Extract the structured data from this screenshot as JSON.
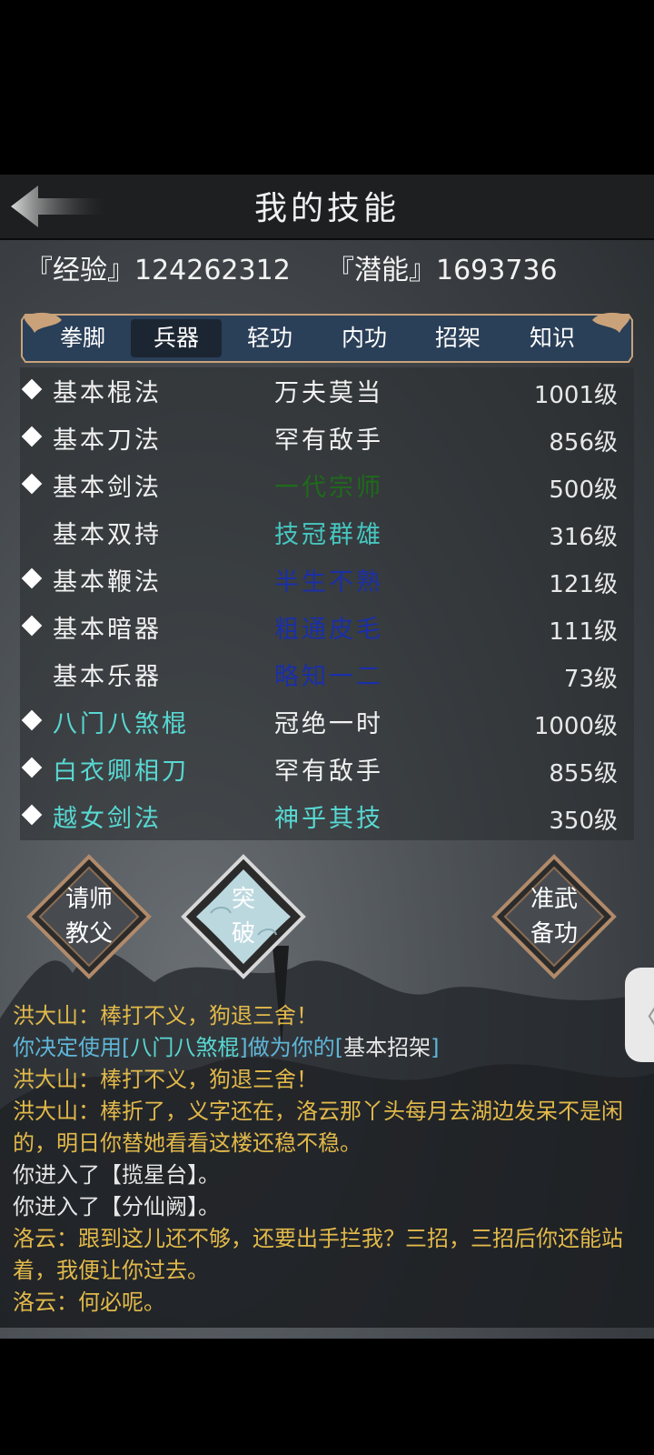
{
  "header": {
    "title": "我的技能"
  },
  "stats": {
    "exp_label": "『经验』",
    "exp_value": "124262312",
    "pot_label": "『潜能』",
    "pot_value": "1693736"
  },
  "tabs": [
    {
      "label": "拳脚"
    },
    {
      "label": "兵器"
    },
    {
      "label": "轻功"
    },
    {
      "label": "内功"
    },
    {
      "label": "招架"
    },
    {
      "label": "知识"
    }
  ],
  "active_tab": "兵器",
  "skills": [
    {
      "name": "基本棍法",
      "rank": "万夫莫当",
      "level": "1001级",
      "marked": true,
      "name_color": "#f2f2f2",
      "rank_color": "#f2f2f2"
    },
    {
      "name": "基本刀法",
      "rank": "罕有敌手",
      "level": "856级",
      "marked": true,
      "name_color": "#f2f2f2",
      "rank_color": "#f2f2f2"
    },
    {
      "name": "基本剑法",
      "rank": "一代宗师",
      "level": "500级",
      "marked": true,
      "name_color": "#f2f2f2",
      "rank_color": "#1e6b1a"
    },
    {
      "name": "基本双持",
      "rank": "技冠群雄",
      "level": "316级",
      "marked": false,
      "name_color": "#f2f2f2",
      "rank_color": "#47c6c0"
    },
    {
      "name": "基本鞭法",
      "rank": "半生不熟",
      "level": "121级",
      "marked": true,
      "name_color": "#f2f2f2",
      "rank_color": "#1a2fa8"
    },
    {
      "name": "基本暗器",
      "rank": "粗通皮毛",
      "level": "111级",
      "marked": true,
      "name_color": "#f2f2f2",
      "rank_color": "#1a2fa8"
    },
    {
      "name": "基本乐器",
      "rank": "略知一二",
      "level": "73级",
      "marked": false,
      "name_color": "#f2f2f2",
      "rank_color": "#1a2fa8"
    },
    {
      "name": "八门八煞棍",
      "rank": "冠绝一时",
      "level": "1000级",
      "marked": true,
      "name_color": "#58d8d2",
      "rank_color": "#f2f2f2"
    },
    {
      "name": "白衣卿相刀",
      "rank": "罕有敌手",
      "level": "855级",
      "marked": true,
      "name_color": "#58d8d2",
      "rank_color": "#f2f2f2"
    },
    {
      "name": "越女剑法",
      "rank": "神乎其技",
      "level": "350级",
      "marked": true,
      "name_color": "#58d8d2",
      "rank_color": "#58d8d2"
    }
  ],
  "buttons": {
    "teacher_line1": "请师",
    "teacher_line2": "教父",
    "breakthrough_line1": "突",
    "breakthrough_line2": "破",
    "prepare_line1": "准武",
    "prepare_line2": "备功"
  },
  "log": [
    {
      "text": "洪大山：棒打不义，狗退三舍！",
      "color": "#e2b94a"
    },
    {
      "text": "",
      "color": "#5fb6d8",
      "parts": [
        "你决定使用[",
        "八门八煞棍",
        "]做为你的[",
        "基本招架",
        "]"
      ]
    },
    {
      "text": "洪大山：棒打不义，狗退三舍！",
      "color": "#e2b94a"
    },
    {
      "text": "洪大山：棒折了，义字还在，洛云那丫头每月去湖边发呆不是闲的，明日你替她看看这楼还稳不稳。",
      "color": "#e2b94a"
    },
    {
      "text": "你进入了【揽星台】。",
      "color": "#e6e6e6"
    },
    {
      "text": "你进入了【分仙阙】。",
      "color": "#e6e6e6"
    },
    {
      "text": "洛云：跟到这儿还不够，还要出手拦我？三招，三招后你还能站着，我便让你过去。",
      "color": "#e2b94a"
    },
    {
      "text": "洛云：何必呢。",
      "color": "#e2b94a"
    }
  ],
  "side_tab": {
    "glyph": "〈"
  },
  "colors": {
    "gold": "#e2b94a",
    "cyan": "#58d8d2",
    "tab_bar": "#2a3f58"
  }
}
